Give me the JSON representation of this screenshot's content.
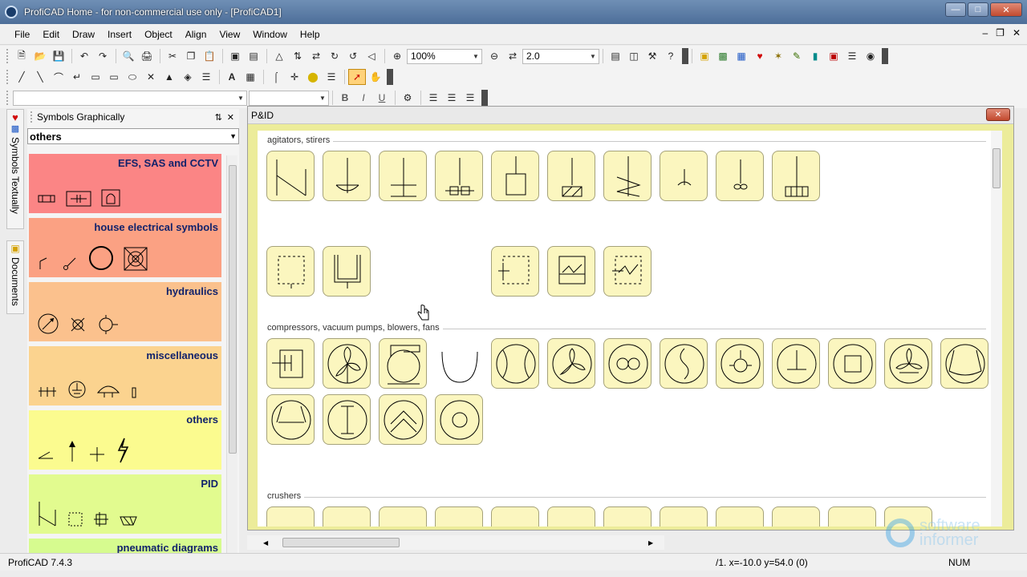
{
  "window": {
    "title": "ProfiCAD Home - for non-commercial use only - [ProfiCAD1]"
  },
  "menu": [
    "File",
    "Edit",
    "Draw",
    "Insert",
    "Object",
    "Align",
    "View",
    "Window",
    "Help"
  ],
  "toolbar": {
    "zoom": "100%",
    "line_width": "2.0",
    "font_name": "",
    "font_size": "",
    "bold": "B",
    "italic": "I",
    "underline": "U"
  },
  "vtabs": {
    "textually": "Symbols Textually",
    "documents": "Documents"
  },
  "panel": {
    "title": "Symbols Graphically",
    "selected": "others",
    "categories": [
      {
        "name": "EFS, SAS and CCTV",
        "color": "#fb8585"
      },
      {
        "name": "house electrical symbols",
        "color": "#fba183"
      },
      {
        "name": "hydraulics",
        "color": "#fbc18d"
      },
      {
        "name": "miscellaneous",
        "color": "#fbd38f"
      },
      {
        "name": "others",
        "color": "#fbfb8f"
      },
      {
        "name": "PID",
        "color": "#e2fb8f"
      },
      {
        "name": "pneumatic diagrams",
        "color": "#d6fb8f"
      }
    ]
  },
  "doc": {
    "title": "P&ID",
    "sections": [
      {
        "name": "agitators, stirers"
      },
      {
        "name": "compressors, vacuum pumps, blowers, fans"
      },
      {
        "name": "crushers"
      }
    ]
  },
  "status": {
    "version": "ProfiCAD 7.4.3",
    "coords": "/1. x=-10.0 y=54.0 (0)",
    "num": "NUM"
  },
  "watermark": {
    "line1": "software",
    "line2": "informer"
  }
}
